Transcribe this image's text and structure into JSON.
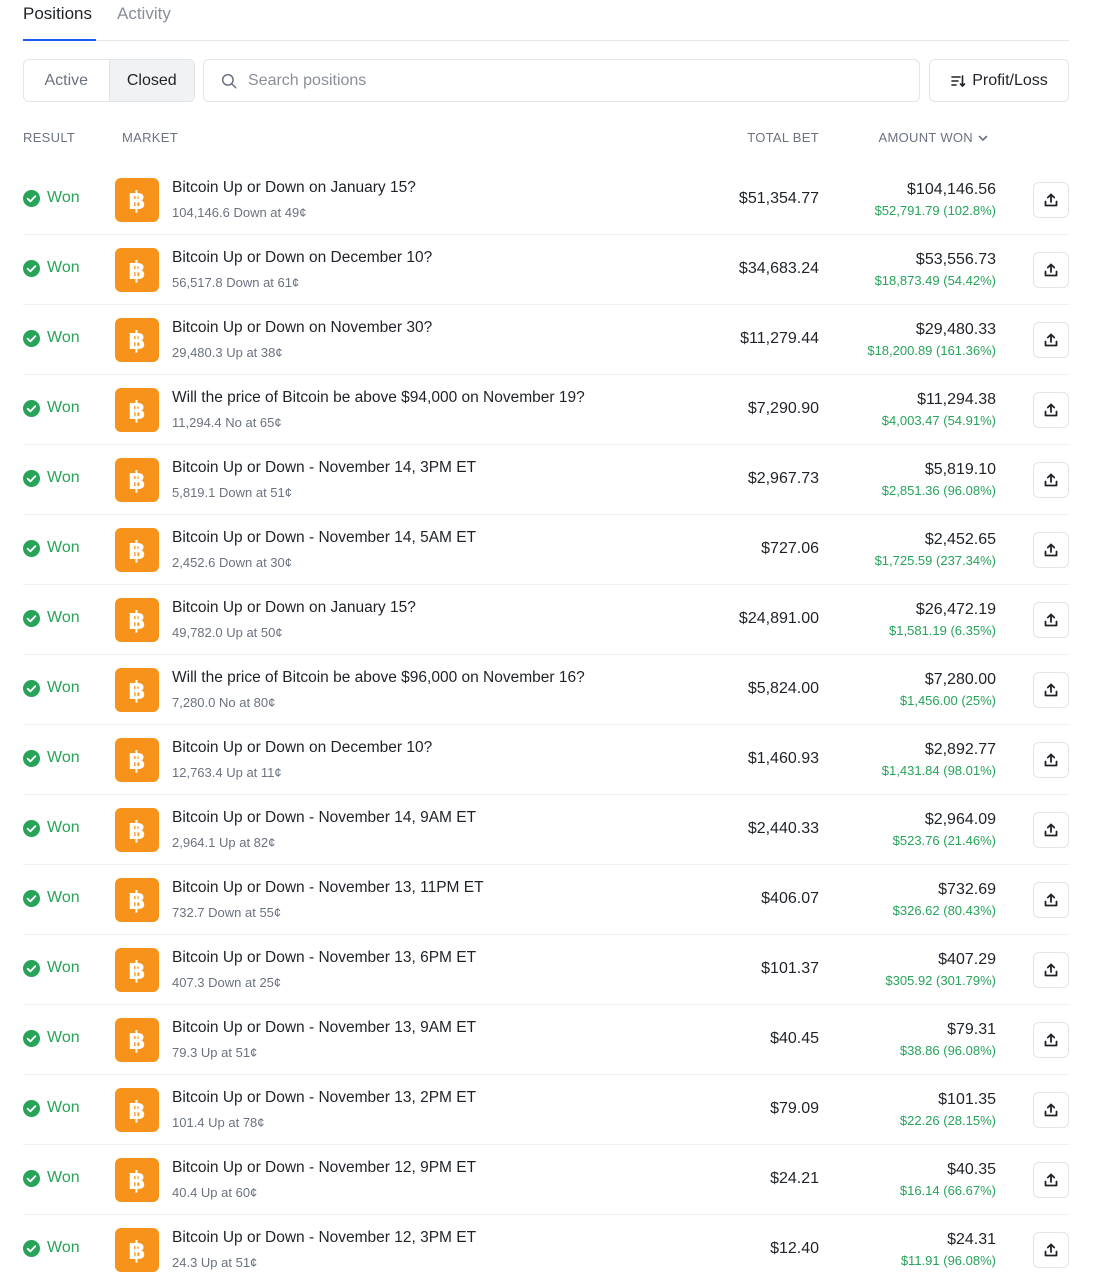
{
  "tabs": {
    "positions": "Positions",
    "activity": "Activity"
  },
  "filter": {
    "active": "Active",
    "closed": "Closed"
  },
  "search": {
    "placeholder": "Search positions"
  },
  "sort": {
    "label": "Profit/Loss"
  },
  "columns": {
    "result": "RESULT",
    "market": "MARKET",
    "total_bet": "TOTAL BET",
    "amount_won": "AMOUNT WON"
  },
  "colors": {
    "accent": "#1a5cf0",
    "won": "#27a35a",
    "bitcoin": "#f7931a"
  },
  "rows": [
    {
      "result": "Won",
      "title": "Bitcoin Up or Down on January 15?",
      "sub": "104,146.6 Down at 49¢",
      "bet": "$51,354.77",
      "amount": "$104,146.56",
      "gain": "$52,791.79 (102.8%)"
    },
    {
      "result": "Won",
      "title": "Bitcoin Up or Down on December 10?",
      "sub": "56,517.8 Down at 61¢",
      "bet": "$34,683.24",
      "amount": "$53,556.73",
      "gain": "$18,873.49 (54.42%)"
    },
    {
      "result": "Won",
      "title": "Bitcoin Up or Down on November 30?",
      "sub": "29,480.3 Up at 38¢",
      "bet": "$11,279.44",
      "amount": "$29,480.33",
      "gain": "$18,200.89 (161.36%)"
    },
    {
      "result": "Won",
      "title": "Will the price of Bitcoin be above $94,000 on November 19?",
      "sub": "11,294.4 No at 65¢",
      "bet": "$7,290.90",
      "amount": "$11,294.38",
      "gain": "$4,003.47 (54.91%)"
    },
    {
      "result": "Won",
      "title": "Bitcoin Up or Down - November 14, 3PM ET",
      "sub": "5,819.1 Down at 51¢",
      "bet": "$2,967.73",
      "amount": "$5,819.10",
      "gain": "$2,851.36 (96.08%)"
    },
    {
      "result": "Won",
      "title": "Bitcoin Up or Down - November 14, 5AM ET",
      "sub": "2,452.6 Down at 30¢",
      "bet": "$727.06",
      "amount": "$2,452.65",
      "gain": "$1,725.59 (237.34%)"
    },
    {
      "result": "Won",
      "title": "Bitcoin Up or Down on January 15?",
      "sub": "49,782.0 Up at 50¢",
      "bet": "$24,891.00",
      "amount": "$26,472.19",
      "gain": "$1,581.19 (6.35%)"
    },
    {
      "result": "Won",
      "title": "Will the price of Bitcoin be above $96,000 on November 16?",
      "sub": "7,280.0 No at 80¢",
      "bet": "$5,824.00",
      "amount": "$7,280.00",
      "gain": "$1,456.00 (25%)"
    },
    {
      "result": "Won",
      "title": "Bitcoin Up or Down on December 10?",
      "sub": "12,763.4 Up at 11¢",
      "bet": "$1,460.93",
      "amount": "$2,892.77",
      "gain": "$1,431.84 (98.01%)"
    },
    {
      "result": "Won",
      "title": "Bitcoin Up or Down - November 14, 9AM ET",
      "sub": "2,964.1 Up at 82¢",
      "bet": "$2,440.33",
      "amount": "$2,964.09",
      "gain": "$523.76 (21.46%)"
    },
    {
      "result": "Won",
      "title": "Bitcoin Up or Down - November 13, 11PM ET",
      "sub": "732.7 Down at 55¢",
      "bet": "$406.07",
      "amount": "$732.69",
      "gain": "$326.62 (80.43%)"
    },
    {
      "result": "Won",
      "title": "Bitcoin Up or Down - November 13, 6PM ET",
      "sub": "407.3 Down at 25¢",
      "bet": "$101.37",
      "amount": "$407.29",
      "gain": "$305.92 (301.79%)"
    },
    {
      "result": "Won",
      "title": "Bitcoin Up or Down - November 13, 9AM ET",
      "sub": "79.3 Up at 51¢",
      "bet": "$40.45",
      "amount": "$79.31",
      "gain": "$38.86 (96.08%)"
    },
    {
      "result": "Won",
      "title": "Bitcoin Up or Down - November 13, 2PM ET",
      "sub": "101.4 Up at 78¢",
      "bet": "$79.09",
      "amount": "$101.35",
      "gain": "$22.26 (28.15%)"
    },
    {
      "result": "Won",
      "title": "Bitcoin Up or Down - November 12, 9PM ET",
      "sub": "40.4 Up at 60¢",
      "bet": "$24.21",
      "amount": "$40.35",
      "gain": "$16.14 (66.67%)"
    },
    {
      "result": "Won",
      "title": "Bitcoin Up or Down - November 12, 3PM ET",
      "sub": "24.3 Up at 51¢",
      "bet": "$12.40",
      "amount": "$24.31",
      "gain": "$11.91 (96.08%)"
    }
  ]
}
